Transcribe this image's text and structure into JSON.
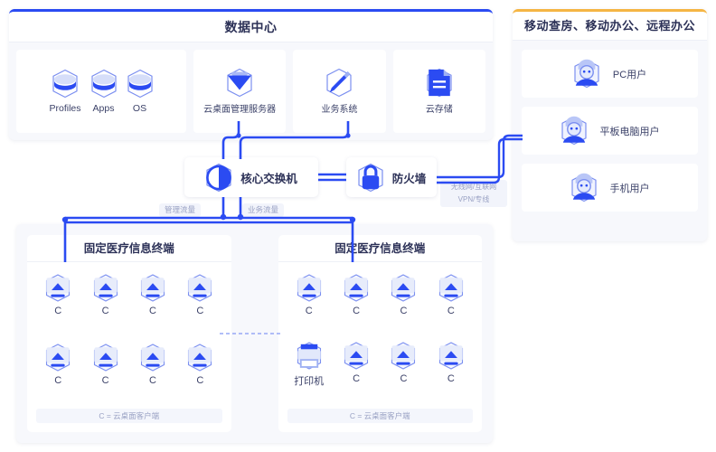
{
  "colors": {
    "accent_blue": "#2b4bf2",
    "accent_orange": "#f5b544",
    "wire": "#2b4bf2",
    "panel_bg": "#f7f8fc",
    "text_dark": "#2c3157",
    "text_muted": "#9aa2c4"
  },
  "data_center": {
    "title": "数据中心",
    "groups": [
      {
        "kind": "triple",
        "items": [
          {
            "label": "Profiles",
            "icon": "database-disc-icon"
          },
          {
            "label": "Apps",
            "icon": "database-disc-icon"
          },
          {
            "label": "OS",
            "icon": "database-disc-icon"
          }
        ]
      },
      {
        "kind": "single",
        "items": [
          {
            "label": "云桌面管理服务器",
            "icon": "cloud-desktop-server-icon"
          }
        ]
      },
      {
        "kind": "single",
        "items": [
          {
            "label": "业务系统",
            "icon": "business-system-icon"
          }
        ]
      },
      {
        "kind": "single",
        "items": [
          {
            "label": "云存储",
            "icon": "cloud-storage-doc-icon"
          }
        ]
      }
    ]
  },
  "mobile_panel": {
    "title": "移动查房、移动办公、远程办公",
    "rows": [
      {
        "label": "PC用户",
        "icon": "user-avatar-icon"
      },
      {
        "label": "平板电脑用户",
        "icon": "user-avatar-icon"
      },
      {
        "label": "手机用户",
        "icon": "user-avatar-icon"
      }
    ]
  },
  "network": {
    "switch": {
      "label": "核心交换机",
      "icon": "core-switch-icon"
    },
    "firewall": {
      "label": "防火墙",
      "icon": "firewall-lock-icon"
    }
  },
  "tags": {
    "management_traffic": "管理流量",
    "business_traffic": "业务流量",
    "wan_link_line1": "无线网/互联网",
    "wan_link_line2": "VPN/专线"
  },
  "terminals": {
    "groups": [
      {
        "title": "固定医疗信息终端",
        "legend": "C = 云桌面客户端",
        "nodes": [
          {
            "label": "C",
            "icon": "thin-client-monitor-icon"
          },
          {
            "label": "C",
            "icon": "thin-client-monitor-icon"
          },
          {
            "label": "C",
            "icon": "thin-client-monitor-icon"
          },
          {
            "label": "C",
            "icon": "thin-client-monitor-icon"
          },
          {
            "label": "C",
            "icon": "thin-client-monitor-icon"
          },
          {
            "label": "C",
            "icon": "thin-client-monitor-icon"
          },
          {
            "label": "C",
            "icon": "thin-client-monitor-icon"
          },
          {
            "label": "C",
            "icon": "thin-client-monitor-icon"
          }
        ]
      },
      {
        "title": "固定医疗信息终端",
        "legend": "C = 云桌面客户端",
        "nodes": [
          {
            "label": "C",
            "icon": "thin-client-monitor-icon"
          },
          {
            "label": "C",
            "icon": "thin-client-monitor-icon"
          },
          {
            "label": "C",
            "icon": "thin-client-monitor-icon"
          },
          {
            "label": "C",
            "icon": "thin-client-monitor-icon"
          },
          {
            "label": "打印机",
            "icon": "printer-icon"
          },
          {
            "label": "C",
            "icon": "thin-client-monitor-icon"
          },
          {
            "label": "C",
            "icon": "thin-client-monitor-icon"
          },
          {
            "label": "C",
            "icon": "thin-client-monitor-icon"
          }
        ]
      }
    ]
  }
}
